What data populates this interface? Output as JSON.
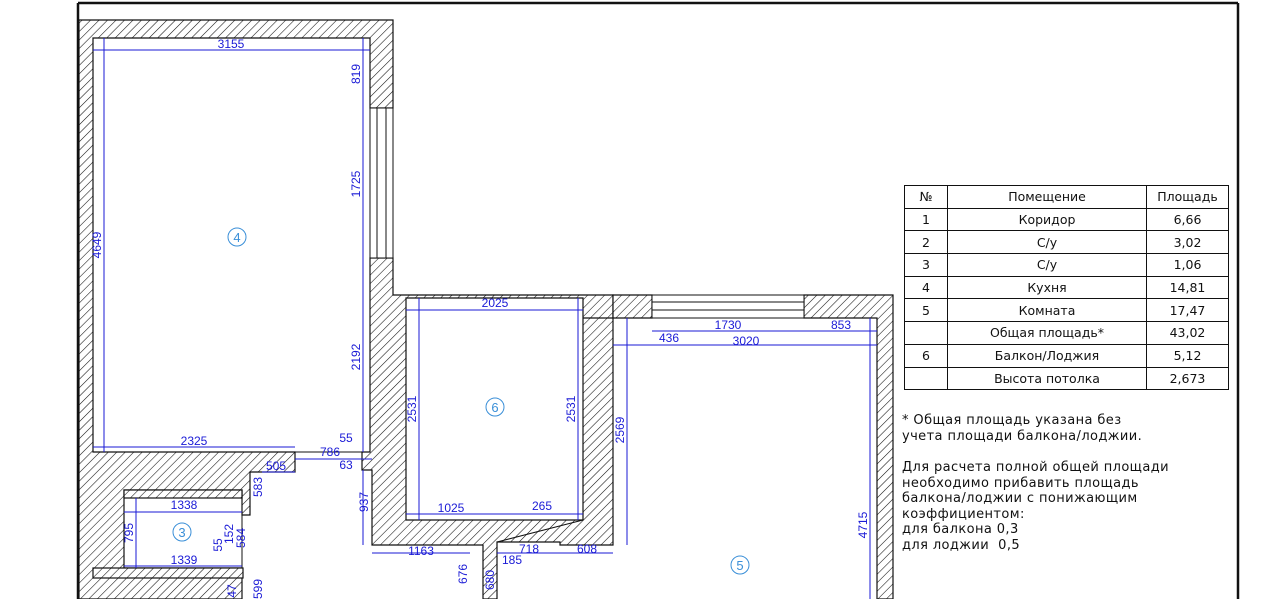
{
  "table": {
    "header": {
      "no": "№",
      "room": "Помещение",
      "area": "Площадь"
    },
    "rows": [
      {
        "no": "1",
        "room": "Коридор",
        "area": "6,66"
      },
      {
        "no": "2",
        "room": "С/у",
        "area": "3,02"
      },
      {
        "no": "3",
        "room": "С/у",
        "area": "1,06"
      },
      {
        "no": "4",
        "room": "Кухня",
        "area": "14,81"
      },
      {
        "no": "5",
        "room": "Комната",
        "area": "17,47"
      },
      {
        "no": "",
        "room": "Общая площадь*",
        "area": "43,02"
      },
      {
        "no": "6",
        "room": "Балкон/Лоджия",
        "area": "5,12"
      },
      {
        "no": "",
        "room": "Высота потолка",
        "area": "2,673"
      }
    ]
  },
  "notes": {
    "note1_line1": "* Общая площадь указана без",
    "note1_line2": "учета площади балкона/лоджии.",
    "note2_line1": "Для расчета полной общей площади",
    "note2_line2": "необходимо прибавить площадь",
    "note2_line3": "балкона/лоджии с понижающим",
    "note2_line4": "коэффициентом:",
    "note2_line5": "для балкона 0,3",
    "note2_line6": "для лоджии  0,5"
  },
  "plan": {
    "rooms": {
      "r3": "3",
      "r4": "4",
      "r5": "5",
      "r6": "6"
    },
    "dims": {
      "d3155": "3155",
      "d819": "819",
      "d1725": "1725",
      "d4649": "4649",
      "d2192": "2192",
      "d2325": "2325",
      "d55a": "55",
      "d786": "786",
      "d63": "63",
      "d505": "505",
      "d937": "937",
      "d1338": "1338",
      "d795": "795",
      "d583": "583",
      "d152": "152",
      "d584": "584",
      "d55b": "55",
      "d1339": "1339",
      "d47": "47",
      "d599": "599",
      "d2025": "2025",
      "d2531a": "2531",
      "d2531b": "2531",
      "d1025": "1025",
      "d265": "265",
      "d1163": "1163",
      "d718": "718",
      "d608": "608",
      "d185": "185",
      "d676": "676",
      "d680": "680",
      "d1730": "1730",
      "d853": "853",
      "d436": "436",
      "d3020": "3020",
      "d2569": "2569",
      "d4715": "4715"
    }
  }
}
